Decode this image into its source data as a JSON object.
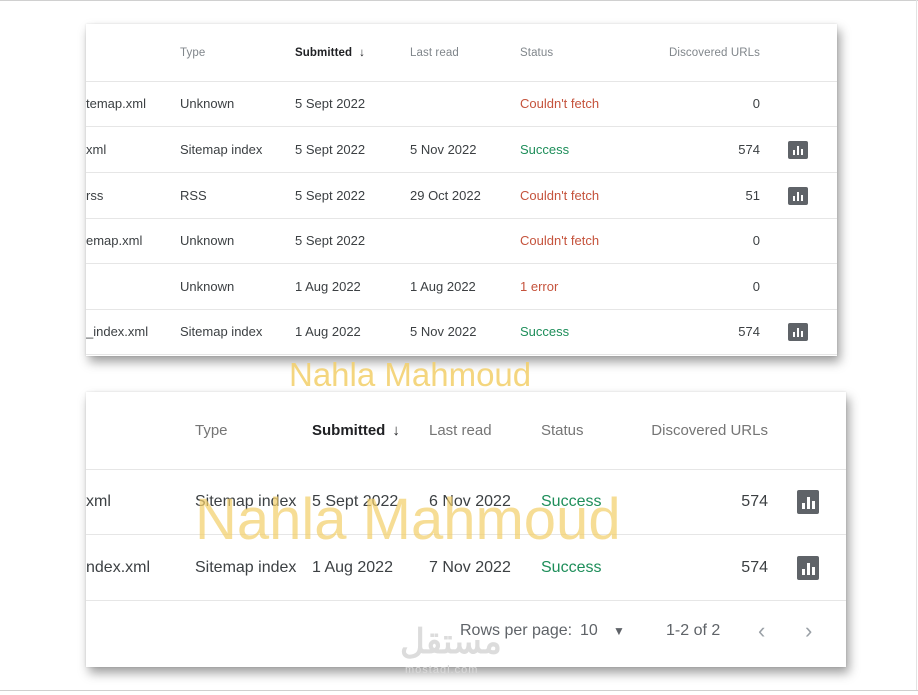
{
  "table_top": {
    "headers": {
      "type": "Type",
      "submitted": "Submitted",
      "last_read": "Last read",
      "status": "Status",
      "discovered_urls": "Discovered URLs"
    },
    "rows": [
      {
        "name": "temap.xml",
        "type": "Unknown",
        "submitted": "5 Sept 2022",
        "last_read": "",
        "status": "Couldn't fetch",
        "urls": "0"
      },
      {
        "name": "xml",
        "type": "Sitemap index",
        "submitted": "5 Sept 2022",
        "last_read": "5 Nov 2022",
        "status": "Success",
        "urls": "574"
      },
      {
        "name": "rss",
        "type": "RSS",
        "submitted": "5 Sept 2022",
        "last_read": "29 Oct 2022",
        "status": "Couldn't fetch",
        "urls": "51"
      },
      {
        "name": "emap.xml",
        "type": "Unknown",
        "submitted": "5 Sept 2022",
        "last_read": "",
        "status": "Couldn't fetch",
        "urls": "0"
      },
      {
        "name": "",
        "type": "Unknown",
        "submitted": "1 Aug 2022",
        "last_read": "1 Aug 2022",
        "status": "1 error",
        "urls": "0"
      },
      {
        "name": "_index.xml",
        "type": "Sitemap index",
        "submitted": "1 Aug 2022",
        "last_read": "5 Nov 2022",
        "status": "Success",
        "urls": "574"
      }
    ]
  },
  "table_bottom": {
    "headers": {
      "type": "Type",
      "submitted": "Submitted",
      "last_read": "Last read",
      "status": "Status",
      "discovered_urls": "Discovered URLs"
    },
    "rows": [
      {
        "name": "xml",
        "type": "Sitemap index",
        "submitted": "5 Sept 2022",
        "last_read": "6 Nov 2022",
        "status": "Success",
        "urls": "574"
      },
      {
        "name": "ndex.xml",
        "type": "Sitemap index",
        "submitted": "1 Aug 2022",
        "last_read": "7 Nov 2022",
        "status": "Success",
        "urls": "574"
      }
    ],
    "pagination": {
      "rows_per_page_label": "Rows per page:",
      "rows_per_page_value": "10",
      "range": "1-2 of 2"
    }
  },
  "watermark": "Nahla Mahmoud",
  "logo": {
    "arabic": "مستقل",
    "latin": "mostaql.com"
  },
  "icons": {
    "sort": "arrow-down-icon",
    "report": "bar-chart-icon",
    "prev": "chevron-left-icon",
    "next": "chevron-right-icon",
    "dropdown": "caret-down-icon"
  },
  "colors": {
    "success": "#1e8e5a",
    "error": "#c5533c",
    "watermark": "#f3cf69"
  }
}
